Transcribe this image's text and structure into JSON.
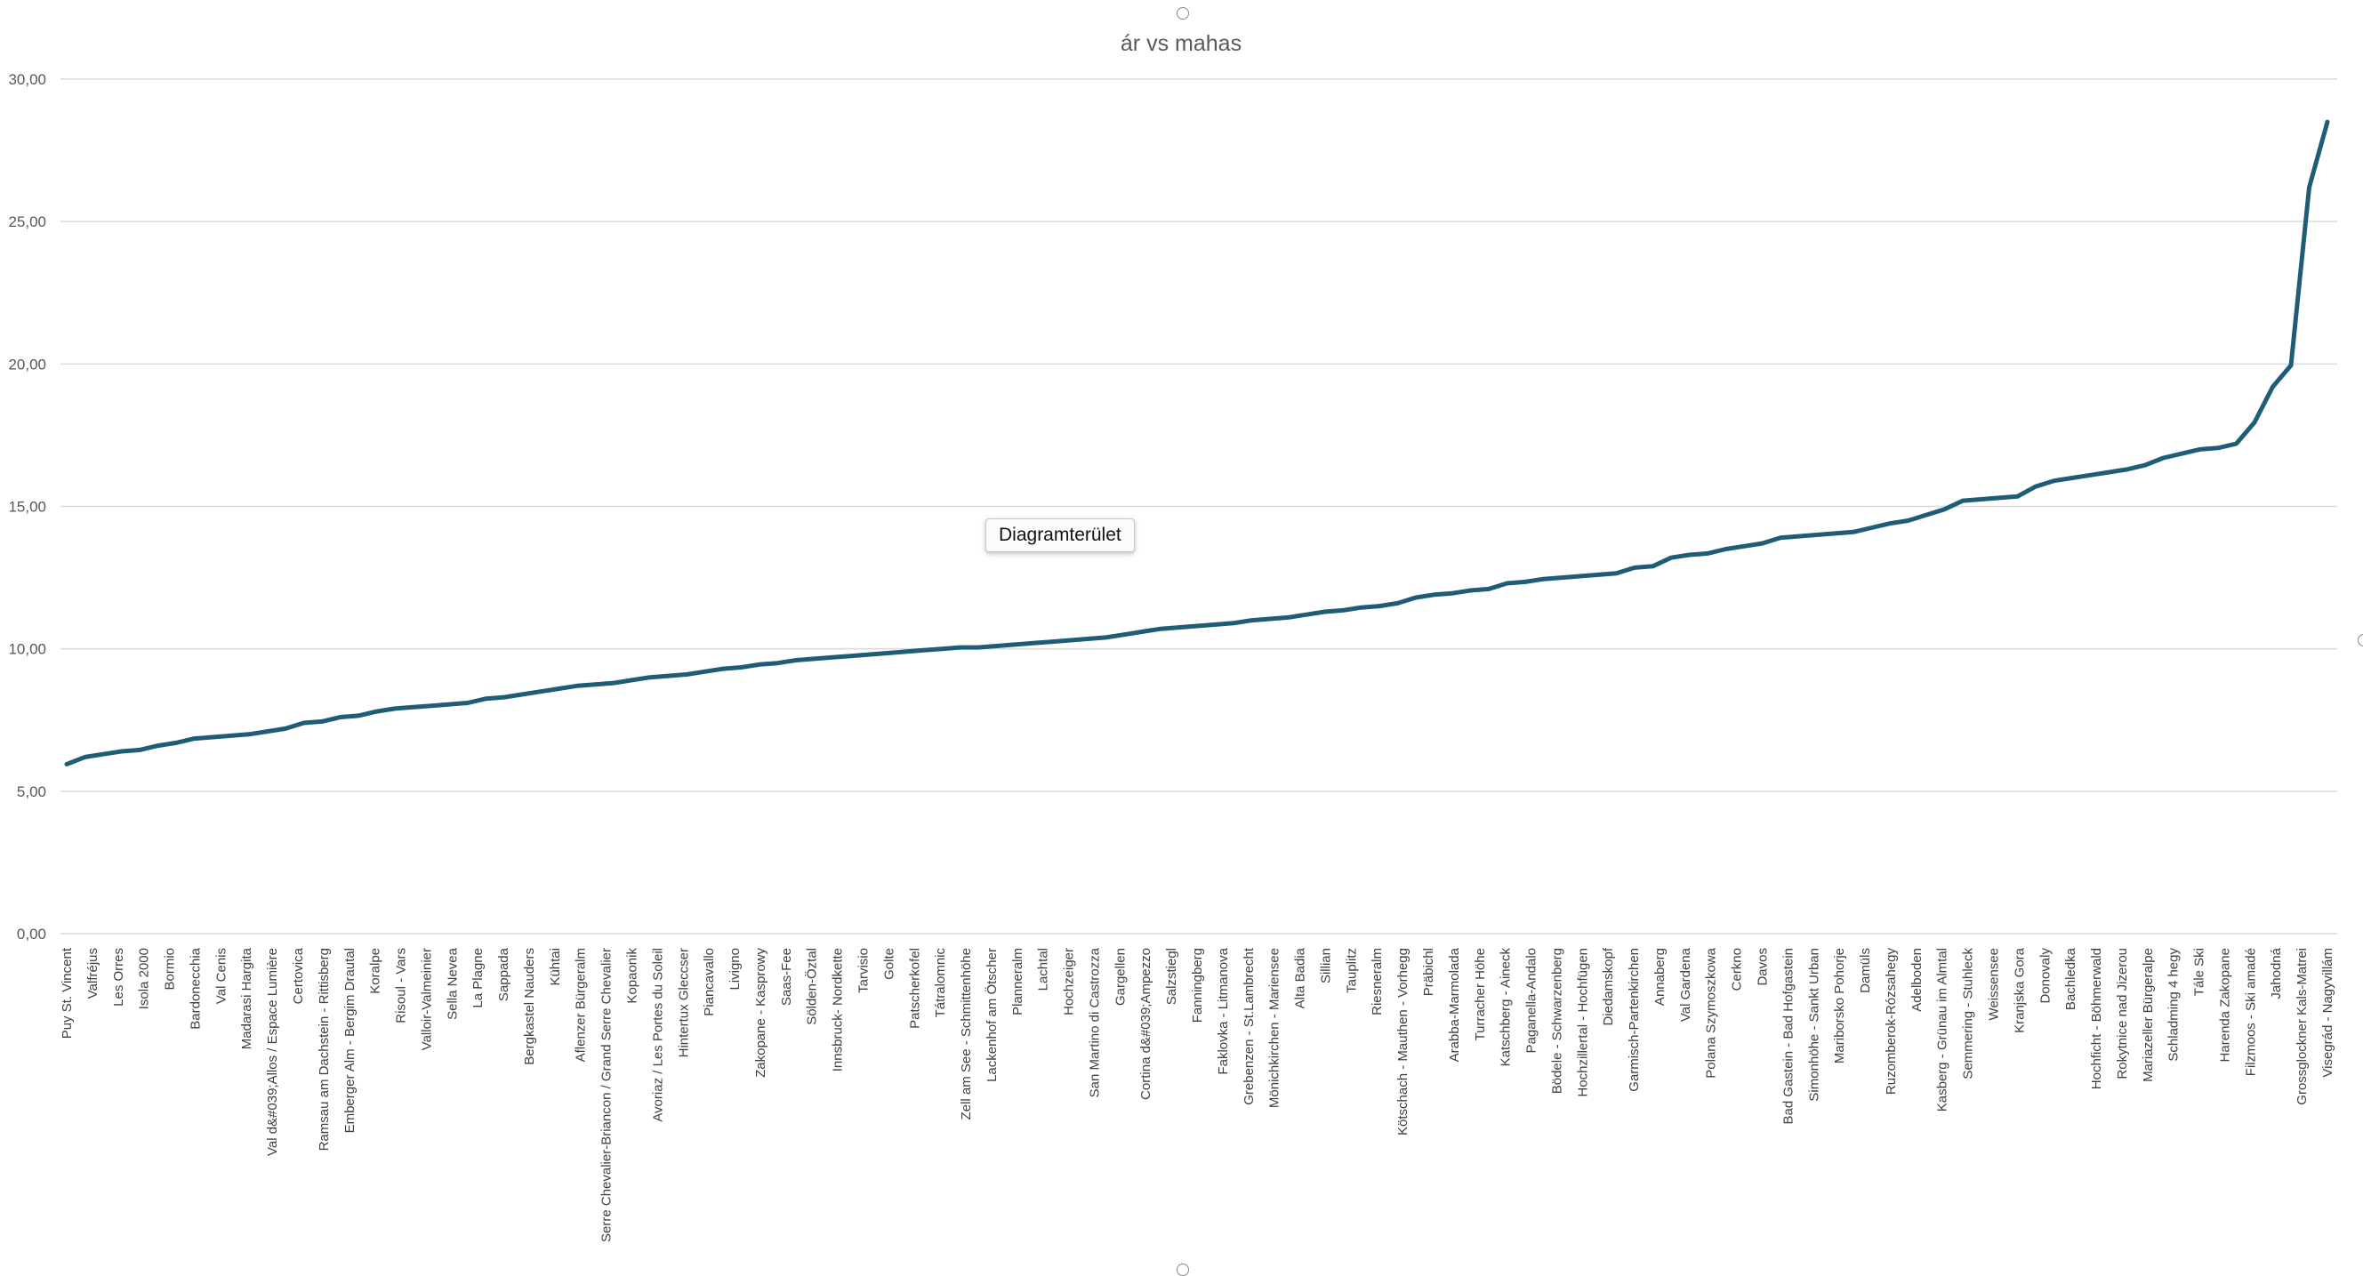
{
  "chart_data": {
    "type": "line",
    "title": "ár vs mahas",
    "xlabel": "",
    "ylabel": "",
    "ylim": [
      0,
      30
    ],
    "yticks": [
      "0,00",
      "5,00",
      "10,00",
      "15,00",
      "20,00",
      "25,00",
      "30,00"
    ],
    "grid": true,
    "legend": "none",
    "line_color": "#1F5C78",
    "categories": [
      "Puy St. Vincent",
      "Valfréjus",
      "Les Orres",
      "Isola 2000",
      "Bormio",
      "Bardonecchia",
      "Val Cenis",
      "Madarasi Hargita",
      "Val d&#039;Allos / Espace Lumière",
      "Certovica",
      "Ramsau am Dachstein - Rittisberg",
      "Emberger Alm - Bergim Drautal",
      "Koralpe",
      "Risoul - Vars",
      "Valloir-Valmeinier",
      "Sella Nevea",
      "La Plagne",
      "Sappada",
      "Bergkastel Nauders",
      "Kühtai",
      "Aflenzer Bürgeralm",
      "Serre Chevalier-Briancon / Grand Serre Chevalier",
      "Kopaonik",
      "Avoriaz / Les Portes du Soleil",
      "Hintertux Gleccser",
      "Piancavallo",
      "Livigno",
      "Zakopane - Kasprowy",
      "Saas-Fee",
      "Sölden-Öztal",
      "Innsbruck- Nordkette",
      "Tarvisio",
      "Golte",
      "Patscherkofel",
      "Tátralomnic",
      "Zell am See - Schmittenhöhe",
      "Lackenhof am Ötscher",
      "Planneralm",
      "Lachtal",
      "Hochzeiger",
      "San Martino di Castrozza",
      "Gargellen",
      "Cortina d&#039;Ampezzo",
      "Salzstiegl",
      "Fanningberg",
      "Faklovka - Litmanova",
      "Grebenzen - St.Lambrecht",
      "Mönichkirchen - Mariensee",
      "Alta Badia",
      "Sillian",
      "Tauplitz",
      "Riesneralm",
      "Kötschach - Mauthen - Vorhegg",
      "Präbichl",
      "Arabba-Marmolada",
      "Turracher Höhe",
      "Katschberg - Aineck",
      "Paganella-Andalo",
      "Bödele - Schwarzenberg",
      "Hochzillertal - Hochfügen",
      "Diedamskopf",
      "Garmisch-Partenkirchen",
      "Annaberg",
      "Val Gardena",
      "Polana Szymoszkowa",
      "Cerkno",
      "Davos",
      "Bad Gastein - Bad Hofgastein",
      "Simonhöhe - Sankt Urban",
      "Mariborsko Pohorje",
      "Damüls",
      "Ruzomberok-Rózsahegy",
      "Adelboden",
      "Kasberg - Grünau im Almtal",
      "Semmering - Stuhleck",
      "Weissensee",
      "Kranjska Gora",
      "Donovaly",
      "Bachledka",
      "Hochficht - Böhmerwald",
      "Rokytnice nad Jizerou",
      "Mariazeller Bürgeralpe",
      "Schladming 4 hegy",
      "Tále Ski",
      "Harenda Zakopane",
      "Filzmoos - Ski amadé",
      "Jahodná",
      "Grossglockner Kals-Matrei",
      "Visegrád - Nagyvillám"
    ],
    "values": [
      5.95,
      6.2,
      6.3,
      6.4,
      6.45,
      6.6,
      6.7,
      6.85,
      6.9,
      6.95,
      7.0,
      7.1,
      7.2,
      7.4,
      7.45,
      7.6,
      7.65,
      7.8,
      7.9,
      7.95,
      8.0,
      8.05,
      8.1,
      8.25,
      8.3,
      8.4,
      8.5,
      8.6,
      8.7,
      8.75,
      8.8,
      8.9,
      9.0,
      9.05,
      9.1,
      9.2,
      9.3,
      9.35,
      9.45,
      9.5,
      9.6,
      9.65,
      9.7,
      9.75,
      9.8,
      9.85,
      9.9,
      9.95,
      10.0,
      10.05,
      10.05,
      10.1,
      10.15,
      10.2,
      10.25,
      10.3,
      10.35,
      10.4,
      10.5,
      10.6,
      10.7,
      10.75,
      10.8,
      10.85,
      10.9,
      11.0,
      11.05,
      11.1,
      11.2,
      11.3,
      11.35,
      11.45,
      11.5,
      11.6,
      11.8,
      11.9,
      11.95,
      12.05,
      12.1,
      12.3,
      12.35,
      12.45,
      12.5,
      12.55,
      12.6,
      12.65,
      12.85,
      12.9,
      13.2,
      13.3,
      13.35,
      13.5,
      13.6,
      13.7,
      13.9,
      13.95,
      14.0,
      14.05,
      14.1,
      14.25,
      14.4,
      14.5,
      14.7,
      14.9,
      15.2,
      15.25,
      15.3,
      15.35,
      15.7,
      15.9,
      16.0,
      16.1,
      16.2,
      16.3,
      16.45,
      16.7,
      16.85,
      17.0,
      17.05,
      17.2,
      17.95,
      19.2,
      19.95,
      26.2,
      28.5
    ]
  },
  "overlay": {
    "tooltip_text": "Diagramterület"
  }
}
